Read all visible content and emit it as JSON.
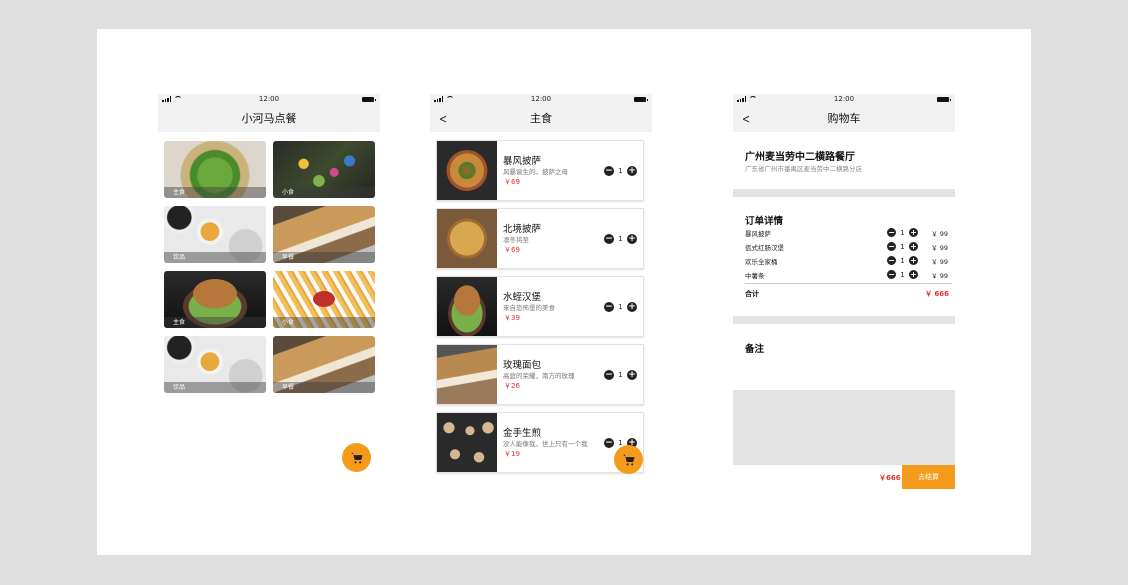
{
  "colors": {
    "accent": "#f59b1b",
    "price": "#e43030",
    "bar": "#f2f2f2"
  },
  "status": {
    "time": "12:00"
  },
  "screen1": {
    "title": "小河马点餐",
    "categories": [
      {
        "label": "主食",
        "image": "kiwi-tart"
      },
      {
        "label": "小食",
        "image": "flower-salad"
      },
      {
        "label": "饮品",
        "image": "tea-breakfast"
      },
      {
        "label": "早餐",
        "image": "bread-loaf"
      },
      {
        "label": "主食",
        "image": "burger"
      },
      {
        "label": "小食",
        "image": "fries"
      },
      {
        "label": "饮品",
        "image": "tea-breakfast"
      },
      {
        "label": "早餐",
        "image": "bread-loaf"
      }
    ],
    "cart_icon": "cart-icon"
  },
  "screen2": {
    "title": "主食",
    "back_icon": "back-chevron-icon",
    "items": [
      {
        "name": "暴风披萨",
        "desc": "风暴诞生的，披萨之母",
        "price": "￥69",
        "qty": "1"
      },
      {
        "name": "北境披萨",
        "desc": "凛冬将至",
        "price": "￥69",
        "qty": "1"
      },
      {
        "name": "水蛭汉堡",
        "desc": "来自恐怖堡的美食",
        "price": "￥39",
        "qty": "1"
      },
      {
        "name": "玫瑰面包",
        "desc": "高庭的荣耀，南方的玫瑰",
        "price": "￥26",
        "qty": "1"
      },
      {
        "name": "金手生煎",
        "desc": "没人能像我，世上只有一个我",
        "price": "￥19",
        "qty": "1"
      }
    ]
  },
  "screen3": {
    "title": "购物车",
    "restaurant": "广州麦当劳中二横路餐厅",
    "address": "广东省广州市番禺区麦当劳中二横路分店",
    "order_title": "订单详情",
    "lines": [
      {
        "name": "暴风披萨",
        "qty": "1",
        "price": "￥ 99"
      },
      {
        "name": "佤式红肠汉堡",
        "qty": "1",
        "price": "￥ 99"
      },
      {
        "name": "欢乐全家桶",
        "qty": "1",
        "price": "￥ 99"
      },
      {
        "name": "中薯条",
        "qty": "1",
        "price": "￥ 99"
      }
    ],
    "total_label": "合计",
    "total_value": "￥ 666",
    "notes_title": "备注",
    "bottom_total": "￥666",
    "checkout_label": "去结算"
  }
}
